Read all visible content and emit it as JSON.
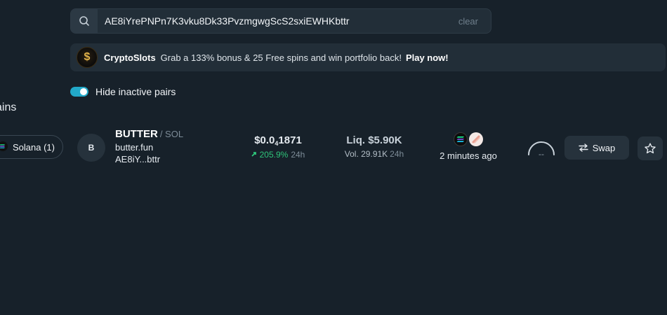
{
  "search": {
    "value": "AE8iYrePNPn7K3vku8Dk33PvzmgwgScS2sxiEWHKbttr",
    "clear_label": "clear",
    "icon": "search-icon"
  },
  "promo": {
    "logo_glyph": "$",
    "brand": "CryptoSlots",
    "text": "Grab a 133% bonus & 25 Free spins and win portfolio back!",
    "cta": "Play now!"
  },
  "filters": {
    "hide_inactive_label": "Hide inactive pairs",
    "hide_inactive_on": true
  },
  "sidebar": {
    "heading_partial": "ains",
    "chain_pill": "Solana (1)"
  },
  "token": {
    "avatar_letter": "B",
    "symbol": "BUTTER",
    "pair": "/ SOL",
    "site": "butter.fun",
    "address_short": "AE8iY...bttr",
    "price_prefix": "$0.0",
    "price_subscript": "4",
    "price_suffix": "1871",
    "change_pct": "205.9%",
    "change_period": "24h",
    "liquidity": "Liq. $5.90K",
    "volume": "Vol. 29.91K",
    "volume_period": "24h",
    "age": "2 minutes ago",
    "score": "--"
  },
  "actions": {
    "swap_label": "Swap"
  },
  "colors": {
    "background": "#17212a",
    "accent_toggle": "#22a9c9",
    "positive": "#2ec47a"
  }
}
